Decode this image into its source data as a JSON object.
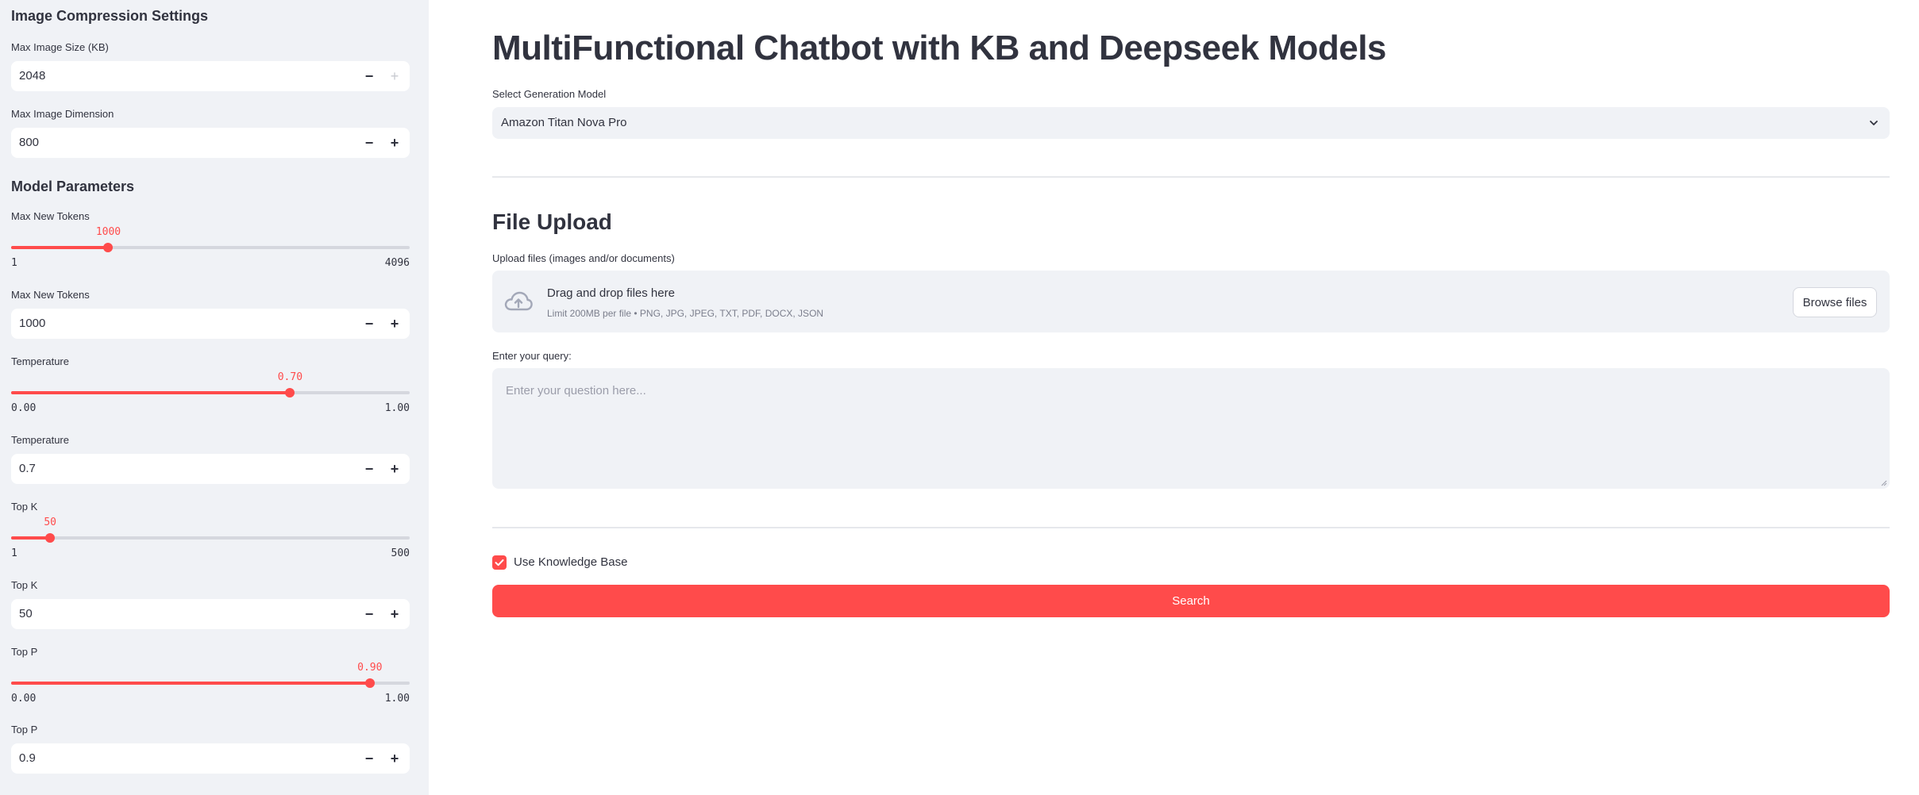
{
  "sidebar": {
    "compression_title": "Image Compression Settings",
    "max_image_size": {
      "label": "Max Image Size (KB)",
      "value": "2048"
    },
    "max_image_dimension": {
      "label": "Max Image Dimension",
      "value": "800"
    },
    "model_params_title": "Model Parameters",
    "max_new_tokens_slider": {
      "label": "Max New Tokens",
      "min": "1",
      "max": "4096",
      "current": "1000",
      "fraction": 0.244
    },
    "max_new_tokens_input": {
      "label": "Max New Tokens",
      "value": "1000"
    },
    "temperature_slider": {
      "label": "Temperature",
      "min": "0.00",
      "max": "1.00",
      "current": "0.70",
      "fraction": 0.7
    },
    "temperature_input": {
      "label": "Temperature",
      "value": "0.7"
    },
    "top_k_slider": {
      "label": "Top K",
      "min": "1",
      "max": "500",
      "current": "50",
      "fraction": 0.098
    },
    "top_k_input": {
      "label": "Top K",
      "value": "50"
    },
    "top_p_slider": {
      "label": "Top P",
      "min": "0.00",
      "max": "1.00",
      "current": "0.90",
      "fraction": 0.9
    },
    "top_p_input": {
      "label": "Top P",
      "value": "0.9"
    },
    "minus_glyph": "−",
    "plus_glyph": "+"
  },
  "main": {
    "title": "MultiFunctional Chatbot with KB and Deepseek Models",
    "model_select": {
      "label": "Select Generation Model",
      "value": "Amazon Titan Nova Pro"
    },
    "file_upload": {
      "heading": "File Upload",
      "label": "Upload files (images and/or documents)",
      "drop_title": "Drag and drop files here",
      "drop_sub": "Limit 200MB per file • PNG, JPG, JPEG, TXT, PDF, DOCX, JSON",
      "browse": "Browse files"
    },
    "query": {
      "label": "Enter your query:",
      "placeholder": "Enter your question here..."
    },
    "use_kb": {
      "label": "Use Knowledge Base",
      "checked": true
    },
    "search_button": "Search"
  },
  "colors": {
    "accent": "#ff4b4b",
    "sidebar_bg": "#f0f2f6",
    "text": "#31333f"
  }
}
